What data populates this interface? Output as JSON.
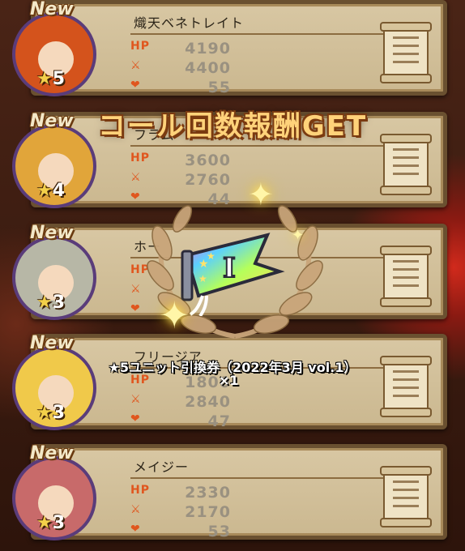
{
  "units": [
    {
      "new_label": "New",
      "name": "熾天ベネトレイト",
      "hp_label": "HP",
      "hp": "4190",
      "atk": "4400",
      "def": "55",
      "rarity_star": "★",
      "rarity": "5",
      "portrait_color": "#d4531c"
    },
    {
      "new_label": "New",
      "name": "フラム",
      "hp_label": "HP",
      "hp": "3600",
      "atk": "2760",
      "def": "44",
      "rarity_star": "★",
      "rarity": "4",
      "portrait_color": "#e1a53a"
    },
    {
      "new_label": "New",
      "name": "ホー",
      "hp_label": "HP",
      "hp": "",
      "atk": "",
      "def": "",
      "rarity_star": "★",
      "rarity": "3",
      "portrait_color": "#b7b7a6"
    },
    {
      "new_label": "New",
      "name": "フリージア",
      "hp_label": "HP",
      "hp": "1800",
      "atk": "2840",
      "def": "47",
      "rarity_star": "★",
      "rarity": "3",
      "portrait_color": "#f0c94a"
    },
    {
      "new_label": "New",
      "name": "メイジー",
      "hp_label": "HP",
      "hp": "2330",
      "atk": "2170",
      "def": "53",
      "rarity_star": "★",
      "rarity": "3",
      "portrait_color": "#c86a6a"
    }
  ],
  "overlay": {
    "title": "コール回数報酬GET",
    "reward_name": "★5ユニット引換券（2022年3月 vol.1）",
    "reward_count": "×1",
    "ticket_roman": "I"
  },
  "colors": {
    "accent": "#ffd27a",
    "card_bg": "#d8c7a3",
    "card_border": "#6a5030"
  }
}
